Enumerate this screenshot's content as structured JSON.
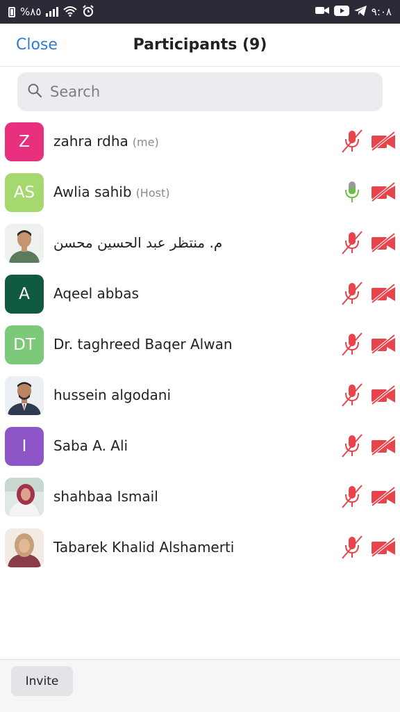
{
  "status_bar": {
    "battery_percent": "%٨٥",
    "time": "٩:٠٨"
  },
  "header": {
    "close_label": "Close",
    "title": "Participants (9)"
  },
  "search": {
    "placeholder": "Search",
    "icon": "search-icon"
  },
  "participants": [
    {
      "name": "zahra rdha",
      "tag": "(me)",
      "initials": "Z",
      "avatar_color": "#e8307f",
      "mic": "muted",
      "video": "off"
    },
    {
      "name": "Awlia sahib",
      "tag": "(Host)",
      "initials": "AS",
      "avatar_color": "#a5d86f",
      "mic": "on",
      "video": "off"
    },
    {
      "name": "م. منتظر عبد الحسين محسن",
      "tag": "",
      "initials": "",
      "avatar_color": "#6b8a6b",
      "mic": "muted",
      "video": "off"
    },
    {
      "name": "Aqeel abbas",
      "tag": "",
      "initials": "A",
      "avatar_color": "#0f5a40",
      "mic": "muted",
      "video": "off"
    },
    {
      "name": "Dr. taghreed Baqer Alwan",
      "tag": "",
      "initials": "DT",
      "avatar_color": "#7cc97a",
      "mic": "muted",
      "video": "off"
    },
    {
      "name": "hussein algodani",
      "tag": "",
      "initials": "",
      "avatar_color": "#3b4a66",
      "mic": "muted",
      "video": "off"
    },
    {
      "name": "Saba A. Ali",
      "tag": "",
      "initials": "I",
      "avatar_color": "#8e55c9",
      "mic": "muted",
      "video": "off"
    },
    {
      "name": "shahbaa Ismail",
      "tag": "",
      "initials": "",
      "avatar_color": "#b0405a",
      "mic": "muted",
      "video": "off"
    },
    {
      "name": "Tabarek Khalid Alshamerti",
      "tag": "",
      "initials": "",
      "avatar_color": "#8a3c4a",
      "mic": "muted",
      "video": "off"
    }
  ],
  "footer": {
    "invite_label": "Invite"
  },
  "colors": {
    "accent": "#2e7cd6",
    "muted_red": "#e8444c",
    "mic_on_green": "#6cc04a"
  }
}
